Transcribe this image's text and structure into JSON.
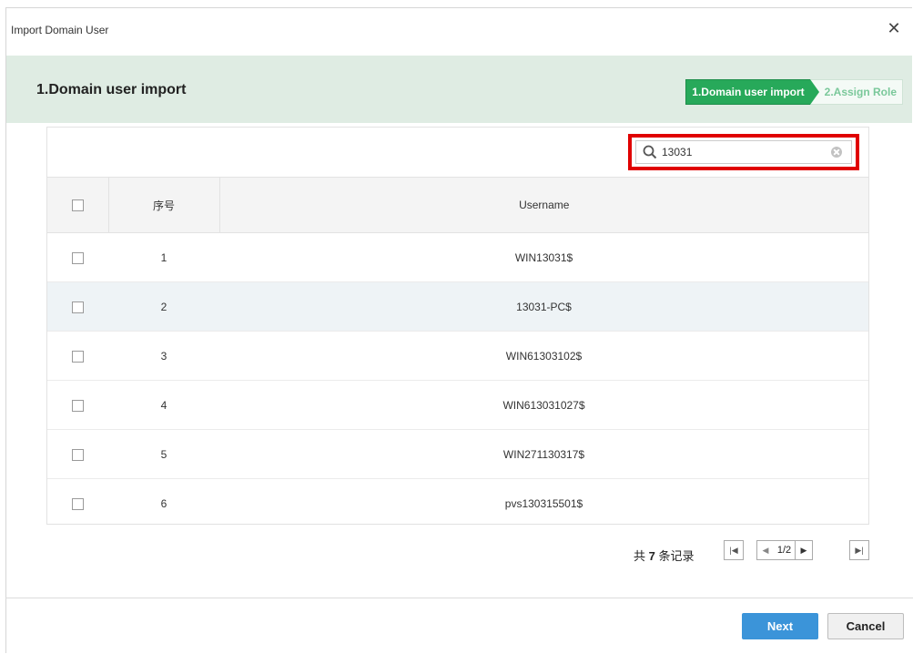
{
  "dialog": {
    "title": "Import Domain User",
    "close_icon": "close-icon"
  },
  "stepbar": {
    "heading": "1.Domain user import",
    "steps": [
      {
        "label": "1.Domain user import",
        "active": true
      },
      {
        "label": "2.Assign Role",
        "active": false
      }
    ],
    "active_color": "#27a95a",
    "background": "#dfece3"
  },
  "search": {
    "value": "13031",
    "icon": "search-icon",
    "clear_icon": "clear-icon",
    "highlight_color": "#e00000"
  },
  "table": {
    "columns": [
      "序号",
      "Username"
    ],
    "rows": [
      {
        "index": "1",
        "username": "WIN13031$"
      },
      {
        "index": "2",
        "username": "13031-PC$"
      },
      {
        "index": "3",
        "username": "WIN61303102$"
      },
      {
        "index": "4",
        "username": "WIN613031027$"
      },
      {
        "index": "5",
        "username": "WIN271130317$"
      },
      {
        "index": "6",
        "username": "pvs130315501$"
      }
    ]
  },
  "pagination": {
    "total_prefix": "共",
    "total_count": "7",
    "total_suffix": "条记录",
    "page": "1/2",
    "first_icon": "first-page-icon",
    "prev_icon": "prev-page-icon",
    "next_icon": "next-page-icon",
    "last_icon": "last-page-icon"
  },
  "footer": {
    "next_label": "Next",
    "cancel_label": "Cancel",
    "next_color": "#3b94d9"
  }
}
